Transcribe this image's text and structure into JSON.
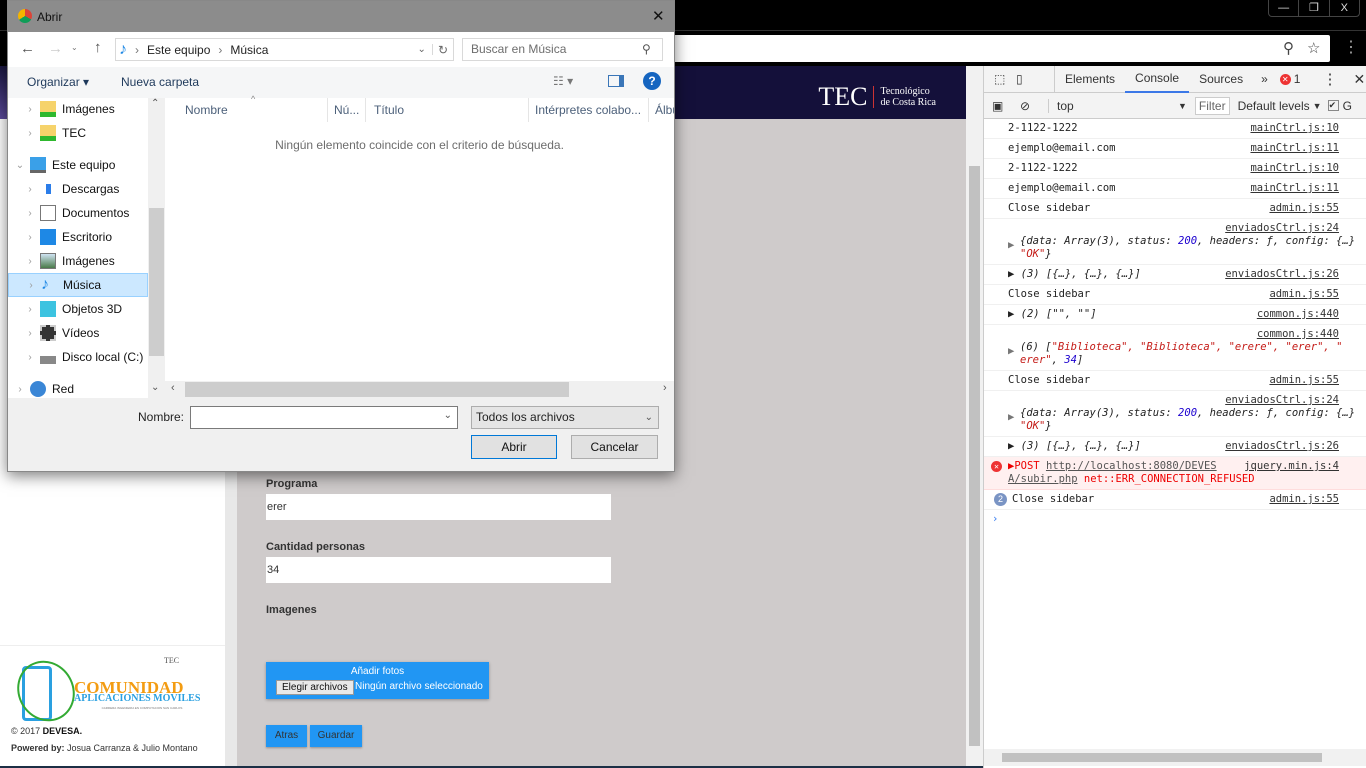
{
  "browser": {
    "window_controls": [
      "—",
      "❐",
      "X"
    ]
  },
  "page": {
    "header_logo": {
      "mark": "TEC",
      "line1": "Tecnológico",
      "line2": "de Costa Rica"
    },
    "form": {
      "programa_label": "Programa",
      "programa_value": "erer",
      "cantidad_label": "Cantidad personas",
      "cantidad_value": "34",
      "imagenes_label": "Imagenes",
      "upload_title": "Añadir fotos",
      "choose_button": "Elegir archivos",
      "no_file": "Ningún archivo seleccionado",
      "back_button": "Atras",
      "save_button": "Guardar"
    },
    "sidebar_footer": {
      "logo_title": "COMUNIDAD",
      "logo_sub": "APLICACIONES MOVILES",
      "logo_tiny": "CARRERA INGENIERIA EN COMPUTACION SAN CARLOS",
      "tec_small": "TEC",
      "copyright_prefix": "© 2017 ",
      "copyright_org": "DEVESA.",
      "powered_label": "Powered by:",
      "powered_names": " Josua Carranza & Julio Montano"
    }
  },
  "devtools": {
    "tabs": [
      "Elements",
      "Console",
      "Sources"
    ],
    "more": "»",
    "error_count": "1",
    "context": "top",
    "filter_placeholder": "Filter",
    "levels": "Default levels",
    "group_label": "G",
    "prompt": "›",
    "rows": [
      {
        "text": "2-1122-1222",
        "src": "mainCtrl.js:10"
      },
      {
        "text": "ejemplo@email.com",
        "src": "mainCtrl.js:11"
      },
      {
        "text": "2-1122-1222",
        "src": "mainCtrl.js:10"
      },
      {
        "text": "ejemplo@email.com",
        "src": "mainCtrl.js:11"
      },
      {
        "text": "Close sidebar",
        "src": "admin.js:55"
      }
    ],
    "obj1": {
      "src": "enviadosCtrl.js:24",
      "a": "{data: Array(3), status: ",
      "status": "200",
      "b": ", headers: ƒ, config: {…}",
      "ok": "\"OK\"",
      "end": "}"
    },
    "arr1": {
      "text": "(3) [{…}, {…}, {…}]",
      "src": "enviadosCtrl.js:26"
    },
    "close2": {
      "text": "Close sidebar",
      "src": "admin.js:55"
    },
    "arr2": {
      "text": "(2) [\"\", \"\"]",
      "src": "common.js:440"
    },
    "arr6": {
      "src": "common.js:440",
      "a": "(6) [",
      "s1": "\"Biblioteca\", \"Biblioteca\", \"erere\", \"erer\", \"",
      "s2": "erer\"",
      ",": ", ",
      "n": "34",
      "end": "]"
    },
    "close3": {
      "text": "Close sidebar",
      "src": "admin.js:55"
    },
    "obj2": {
      "src": "enviadosCtrl.js:24"
    },
    "arr3": {
      "text": "(3) [{…}, {…}, {…}]",
      "src": "enviadosCtrl.js:26"
    },
    "error": {
      "method": "POST ",
      "url1": "http://localhost:8080/DEVES",
      "url2": "A/subir.php",
      "msg": " net::ERR_CONNECTION_REFUSED",
      "src": "jquery.min.js:4"
    },
    "last": {
      "count": "2",
      "text": "Close sidebar",
      "src": "admin.js:55"
    }
  },
  "dialog": {
    "title": "Abrir",
    "close": "✕",
    "path": [
      "Este equipo",
      "Música"
    ],
    "search_placeholder": "Buscar en Música",
    "organize": "Organizar ▾",
    "new_folder": "Nueva carpeta",
    "help": "?",
    "tree": [
      {
        "label": "Imágenes",
        "icon": "folder-synced-icon"
      },
      {
        "label": "TEC",
        "icon": "folder-synced-icon"
      },
      {
        "label": "Este equipo",
        "icon": "computer-icon"
      },
      {
        "label": "Descargas",
        "icon": "download-icon"
      },
      {
        "label": "Documentos",
        "icon": "document-icon"
      },
      {
        "label": "Escritorio",
        "icon": "desktop-icon"
      },
      {
        "label": "Imágenes",
        "icon": "pictures-icon"
      },
      {
        "label": "Música",
        "icon": "music-icon"
      },
      {
        "label": "Objetos 3D",
        "icon": "cube-icon"
      },
      {
        "label": "Vídeos",
        "icon": "video-icon"
      },
      {
        "label": "Disco local (C:)",
        "icon": "drive-icon"
      },
      {
        "label": "Red",
        "icon": "network-icon"
      }
    ],
    "columns": [
      "Nombre",
      "Nú...",
      "Título",
      "Intérpretes colabo...",
      "Álbum"
    ],
    "empty_message": "Ningún elemento coincide con el criterio de búsqueda.",
    "filename_label": "Nombre:",
    "filename_value": "",
    "filetype": "Todos los archivos",
    "open_button": "Abrir",
    "cancel_button": "Cancelar"
  }
}
